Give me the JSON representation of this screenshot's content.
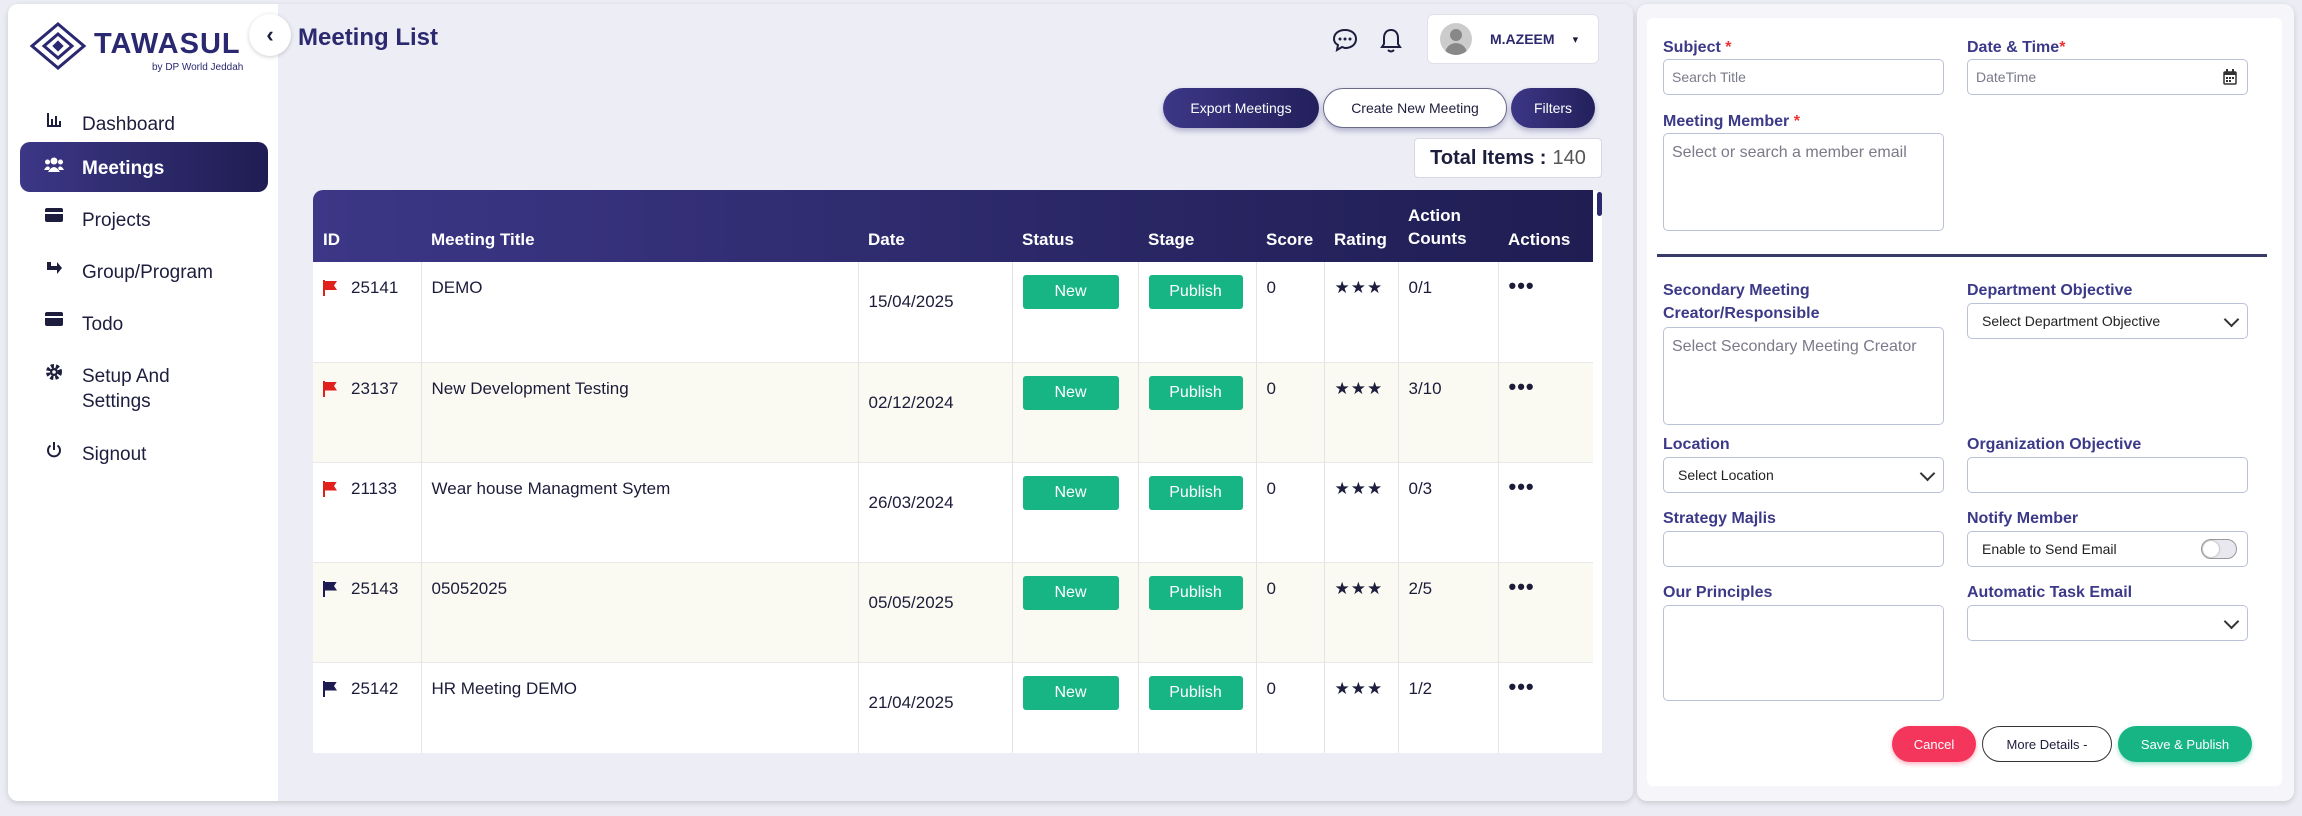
{
  "app": {
    "brand": "TAWASUL",
    "brand_sub": "by DP World Jeddah"
  },
  "sidebar": {
    "items": [
      {
        "label": "Dashboard",
        "icon": "chart-icon"
      },
      {
        "label": "Meetings",
        "icon": "users-icon"
      },
      {
        "label": "Projects",
        "icon": "card-icon"
      },
      {
        "label": "Group/Program",
        "icon": "share-icon"
      },
      {
        "label": "Todo",
        "icon": "card-icon"
      },
      {
        "label": "Setup And Settings",
        "icon": "gear-icon"
      },
      {
        "label": "Signout",
        "icon": "power-icon"
      }
    ]
  },
  "header": {
    "title": "Meeting List",
    "user_name": "M.AZEEM"
  },
  "toolbar": {
    "export_label": "Export Meetings",
    "create_label": "Create New Meeting",
    "filters_label": "Filters",
    "total_label": "Total Items :",
    "total_value": "140"
  },
  "table": {
    "columns": [
      "ID",
      "Meeting Title",
      "Date",
      "Status",
      "Stage",
      "Score",
      "Rating",
      "Action Counts",
      "Actions"
    ],
    "rows": [
      {
        "id": "25141",
        "title": "DEMO",
        "date": "15/04/2025",
        "status": "New",
        "stage": "Publish",
        "score": "0",
        "rating": "★★★",
        "counts": "0/1",
        "flag_color": "#e0201c"
      },
      {
        "id": "23137",
        "title": "New Development Testing",
        "date": "02/12/2024",
        "status": "New",
        "stage": "Publish",
        "score": "0",
        "rating": "★★★",
        "counts": "3/10",
        "flag_color": "#e0201c"
      },
      {
        "id": "21133",
        "title": "Wear house Managment Sytem",
        "date": "26/03/2024",
        "status": "New",
        "stage": "Publish",
        "score": "0",
        "rating": "★★★",
        "counts": "0/3",
        "flag_color": "#e0201c"
      },
      {
        "id": "25143",
        "title": "05052025",
        "date": "05/05/2025",
        "status": "New",
        "stage": "Publish",
        "score": "0",
        "rating": "★★★",
        "counts": "2/5",
        "flag_color": "#1d1b52"
      },
      {
        "id": "25142",
        "title": "HR Meeting DEMO",
        "date": "21/04/2025",
        "status": "New",
        "stage": "Publish",
        "score": "0",
        "rating": "★★★",
        "counts": "1/2",
        "flag_color": "#1d1b52"
      }
    ]
  },
  "form": {
    "subject_label": "Subject",
    "subject_placeholder": "Search Title",
    "datetime_label": "Date & Time",
    "datetime_placeholder": "DateTime",
    "member_label": "Meeting Member",
    "member_placeholder": "Select or search a member email",
    "secondary_label": "Secondary Meeting Creator/Responsible",
    "secondary_placeholder": "Select Secondary Meeting Creator",
    "dept_label": "Department Objective",
    "dept_value": "Select Department Objective",
    "location_label": "Location",
    "location_value": "Select Location",
    "org_label": "Organization Objective",
    "strategy_label": "Strategy Majlis",
    "notify_label": "Notify Member",
    "notify_toggle_label": "Enable to Send Email",
    "principles_label": "Our Principles",
    "auto_task_label": "Automatic Task Email",
    "cancel_label": "Cancel",
    "more_label": "More Details -",
    "save_label": "Save & Publish"
  },
  "colors": {
    "brand": "#2c2a6e",
    "accent_green": "#17b583",
    "cancel_red": "#f5365c",
    "label_purple": "#3c3a88"
  }
}
